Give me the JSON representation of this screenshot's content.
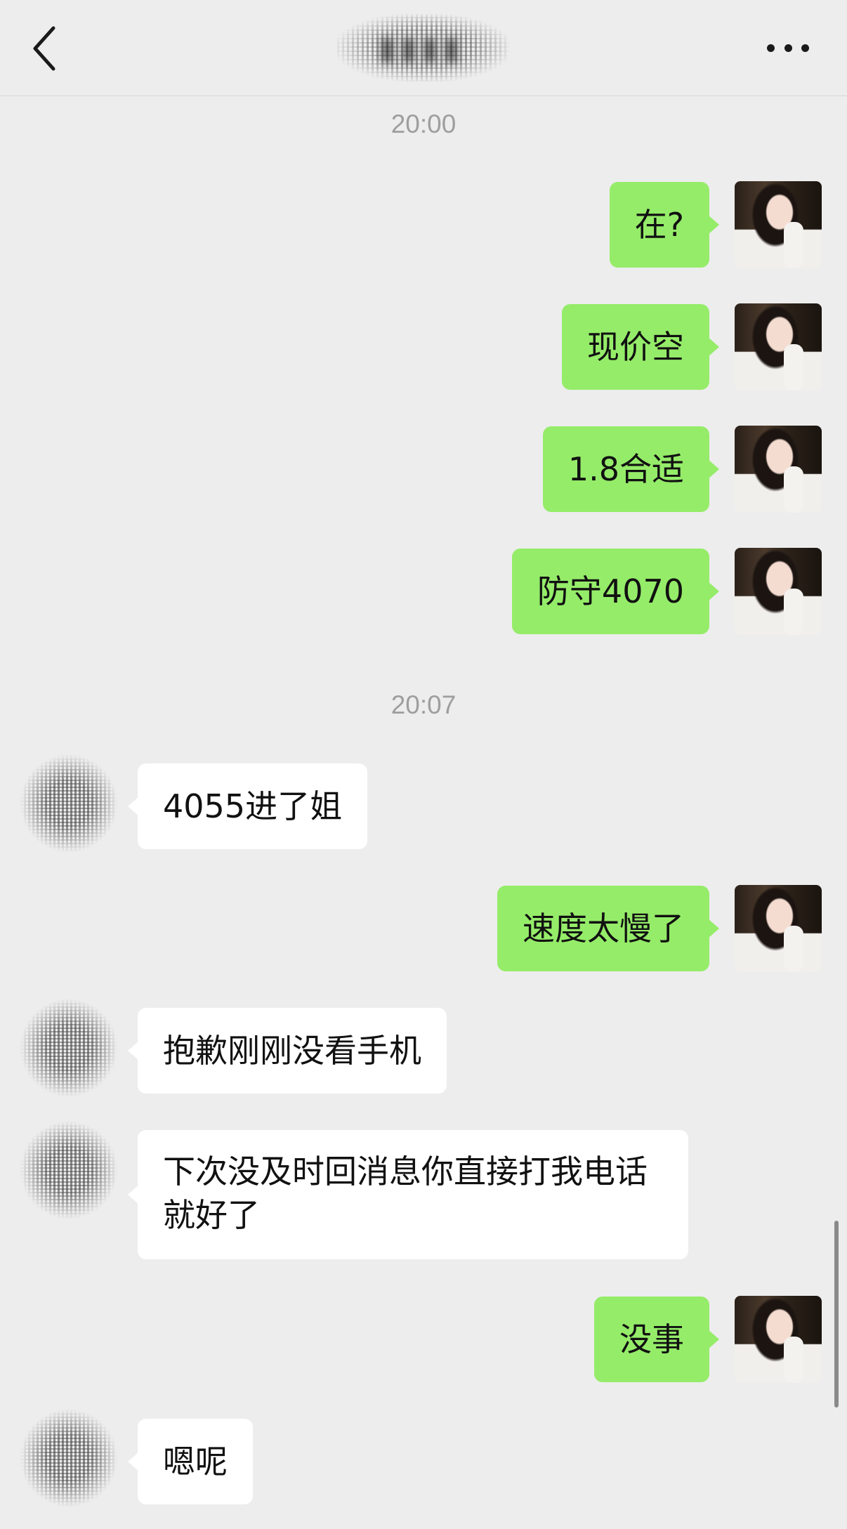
{
  "header": {
    "back_icon": "chevron-left-icon",
    "title": "▮▮▮▮",
    "more_icon": "more-dots-icon"
  },
  "colors": {
    "background": "#ededed",
    "outgoing_bubble": "#95ec69",
    "incoming_bubble": "#ffffff",
    "timestamp": "#9e9e9e"
  },
  "timestamps": [
    "20:00",
    "20:07"
  ],
  "messages": [
    {
      "side": "out",
      "text": "在?"
    },
    {
      "side": "out",
      "text": "现价空"
    },
    {
      "side": "out",
      "text": "1.8合适"
    },
    {
      "side": "out",
      "text": "防守4070"
    },
    {
      "side": "in",
      "text": "4055进了姐"
    },
    {
      "side": "out",
      "text": "速度太慢了"
    },
    {
      "side": "in",
      "text": "抱歉刚刚没看手机"
    },
    {
      "side": "in",
      "text": "下次没及时回消息你直接打我电话就好了"
    },
    {
      "side": "out",
      "text": "没事"
    },
    {
      "side": "in",
      "text": "嗯呢"
    }
  ]
}
